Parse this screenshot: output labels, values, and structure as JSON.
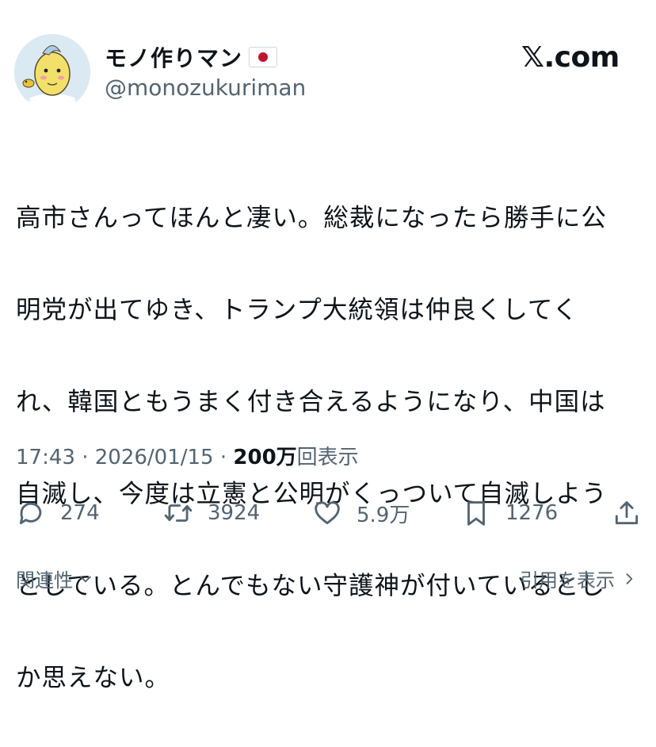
{
  "author": {
    "display_name": "モノ作りマン",
    "handle": "@monozukuriman",
    "flag_icon": "japan-flag-icon"
  },
  "site": "𝕏.com",
  "tweet": {
    "lines": [
      "高市さんってほんと凄い。総裁になったら勝手に公",
      "明党が出てゆき、トランプ大統領は仲良くしてく",
      "れ、韓国ともうまく付き合えるようになり、中国は",
      "自滅し、今度は立憲と公明がくっついて自滅しよう",
      "としている。とんでもない守護神が付いているとし",
      "か思えない。"
    ]
  },
  "meta": {
    "time": "17:43",
    "separator": "·",
    "date": "2026/01/15",
    "views_count": "200万",
    "views_label": "回表示"
  },
  "actions": {
    "replies": "274",
    "retweets": "3924",
    "likes": "5.9万",
    "bookmarks": "1276"
  },
  "footer": {
    "related": "関連性",
    "quotes": "引用を表示"
  },
  "colors": {
    "text": "#0f1419",
    "secondary": "#536471",
    "flag_red": "#c0142e"
  }
}
